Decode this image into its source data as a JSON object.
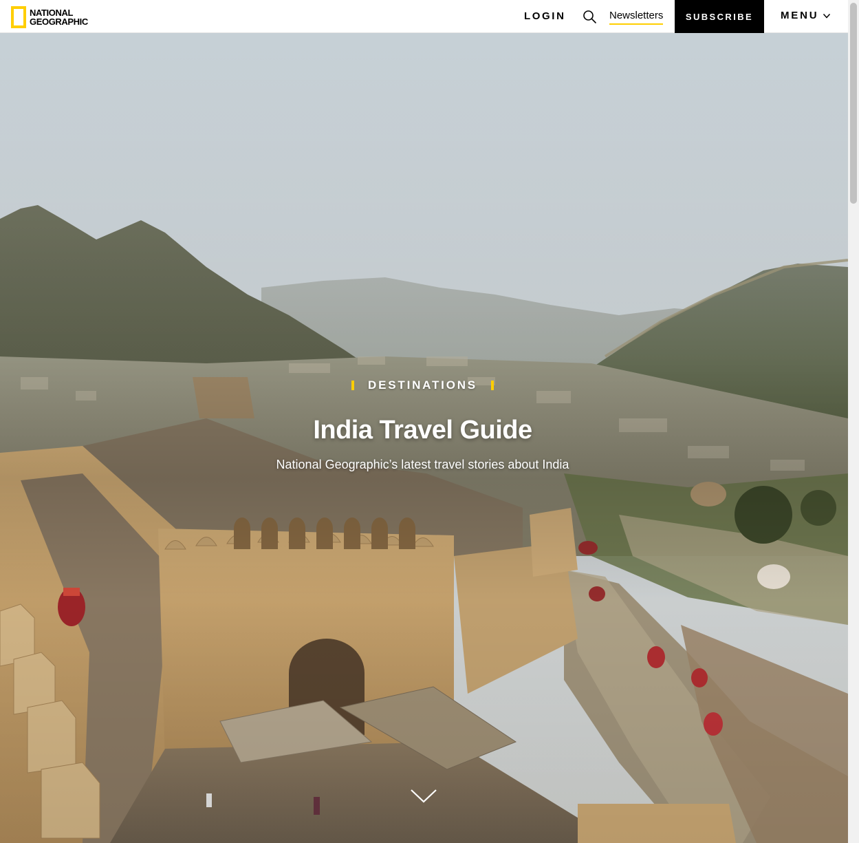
{
  "header": {
    "logo": {
      "line1": "NATIONAL",
      "line2": "GEOGRAPHIC",
      "color": "#ffce00"
    },
    "login_label": "LOGIN",
    "search_icon": "search-icon",
    "newsletters_label": "Newsletters",
    "subscribe_label": "SUBSCRIBE",
    "menu_label": "MENU",
    "menu_icon": "chevron-down-icon"
  },
  "hero": {
    "eyebrow": "DESTINATIONS",
    "title": "India Travel Guide",
    "subtitle": "National Geographic’s latest travel stories about India",
    "scroll_icon": "chevron-down-icon",
    "image_subject": "Amber Fort ramparts above Jaipur with elephants and hills"
  },
  "colors": {
    "accent_yellow": "#ffce00",
    "subscribe_bg": "#000000",
    "header_bg": "#ffffff"
  }
}
